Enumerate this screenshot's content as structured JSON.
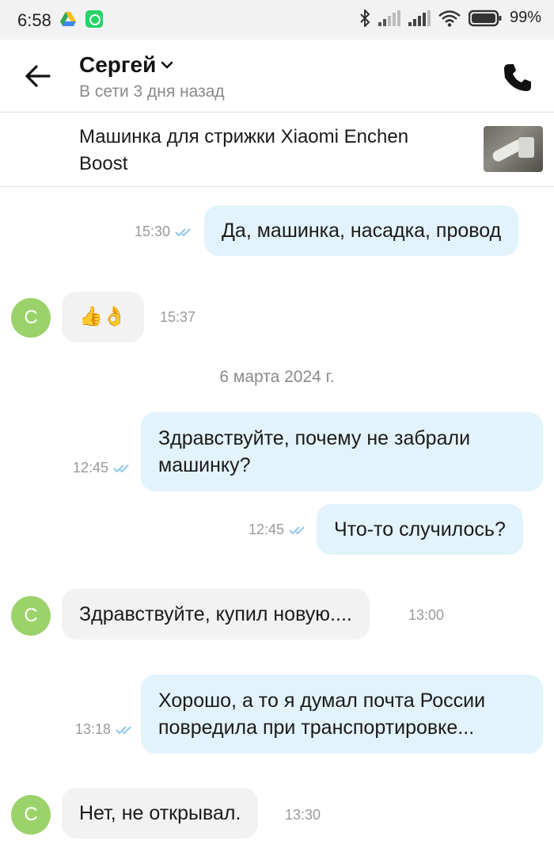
{
  "status_bar": {
    "time": "6:58",
    "battery_text": "99%",
    "icons": [
      "google-drive-icon",
      "whatsapp-icon",
      "bluetooth-icon",
      "signal-icon",
      "signal-icon",
      "wifi-icon",
      "battery-icon"
    ]
  },
  "header": {
    "name": "Сергей",
    "status": "В сети 3 дня назад"
  },
  "product": {
    "title": "Машинка для стрижки Xiaomi Enchen Boost"
  },
  "contact": {
    "avatar_letter": "С",
    "avatar_color": "#9bd36a"
  },
  "colors": {
    "outgoing_bubble": "#e3f3fc",
    "incoming_bubble": "#f2f2f2",
    "read_ticks": "#8fc8ea"
  },
  "messages": [
    {
      "dir": "out",
      "text": "Да, машинка, насадка, провод",
      "time": "15:30"
    },
    {
      "dir": "in",
      "text": "👍👌",
      "time": "15:37"
    },
    {
      "type": "date",
      "text": "6 марта 2024 г."
    },
    {
      "dir": "out",
      "text": "Здравствуйте, почему не забрали машинку?",
      "time": "12:45"
    },
    {
      "dir": "out",
      "text": "Что-то случилось?",
      "time": "12:45"
    },
    {
      "dir": "in",
      "text": "Здравствуйте, купил новую....",
      "time": "13:00"
    },
    {
      "dir": "out",
      "text": "Хорошо, а то я думал почта России повредила при транспортировке...",
      "time": "13:18"
    },
    {
      "dir": "in",
      "text": "Нет, не открывал.",
      "time": "13:30"
    }
  ]
}
